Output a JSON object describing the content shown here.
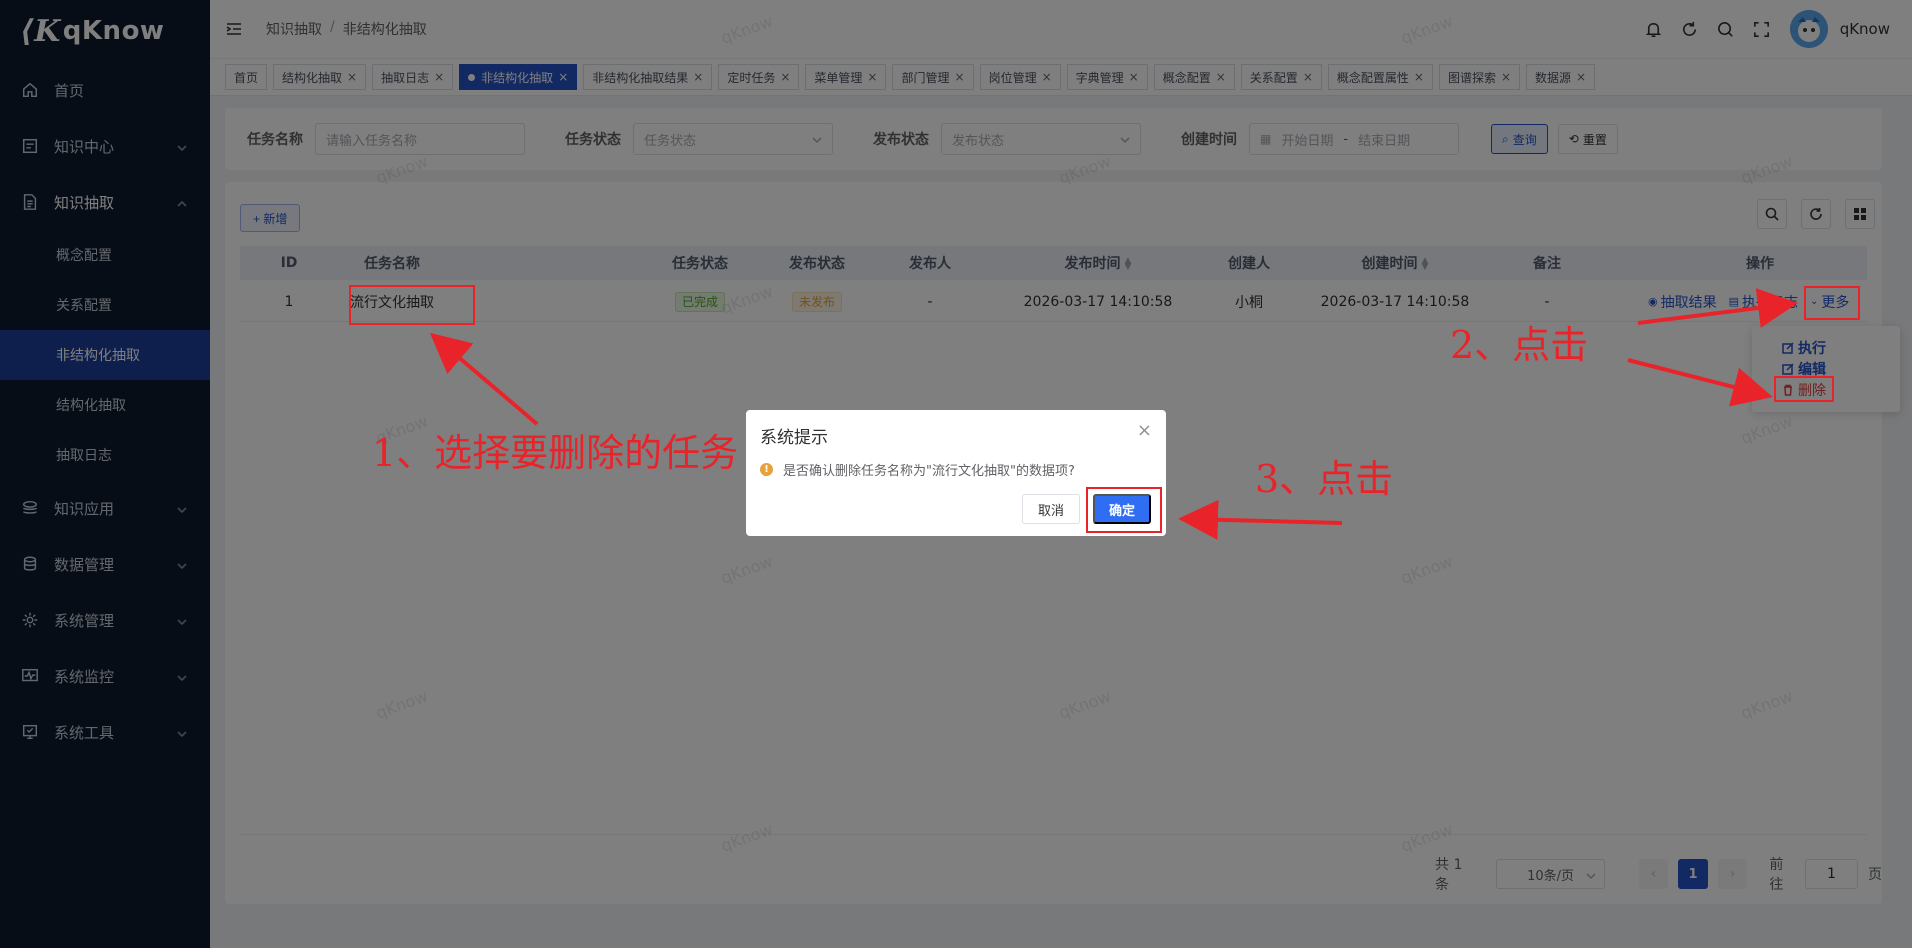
{
  "app": {
    "logo": "qKnow"
  },
  "sidebar": {
    "items": [
      {
        "label": "首页",
        "icon": "home-icon"
      },
      {
        "label": "知识中心",
        "icon": "book-icon"
      },
      {
        "label": "知识抽取",
        "icon": "document-icon"
      },
      {
        "label": "知识应用",
        "icon": "layers-icon"
      },
      {
        "label": "数据管理",
        "icon": "database-icon"
      },
      {
        "label": "系统管理",
        "icon": "gear-icon"
      },
      {
        "label": "系统监控",
        "icon": "monitor-icon"
      },
      {
        "label": "系统工具",
        "icon": "tool-icon"
      }
    ],
    "sub_items": [
      "概念配置",
      "关系配置",
      "非结构化抽取",
      "结构化抽取",
      "抽取日志"
    ]
  },
  "header": {
    "breadcrumb": [
      "知识抽取",
      "非结构化抽取"
    ],
    "username": "qKnow"
  },
  "tags": [
    "首页",
    "结构化抽取",
    "抽取日志",
    "非结构化抽取",
    "非结构化抽取结果",
    "定时任务",
    "菜单管理",
    "部门管理",
    "岗位管理",
    "字典管理",
    "概念配置",
    "关系配置",
    "概念配置属性",
    "图谱探索",
    "数据源"
  ],
  "search": {
    "task_name_label": "任务名称",
    "task_name_placeholder": "请输入任务名称",
    "task_status_label": "任务状态",
    "task_status_placeholder": "任务状态",
    "publish_status_label": "发布状态",
    "publish_status_placeholder": "发布状态",
    "create_time_label": "创建时间",
    "start_placeholder": "开始日期",
    "range_sep": "-",
    "end_placeholder": "结束日期",
    "query_label": "查询",
    "reset_label": "重置"
  },
  "toolbar": {
    "add_label": "+ 新增"
  },
  "table": {
    "columns": [
      "ID",
      "任务名称",
      "任务状态",
      "发布状态",
      "发布人",
      "发布时间",
      "创建人",
      "创建时间",
      "备注",
      "操作"
    ],
    "rows": [
      {
        "id": "1",
        "name": "流行文化抽取",
        "status": "已完成",
        "publish_status": "未发布",
        "publisher": "-",
        "publish_time": "2026-03-17 14:10:58",
        "creator": "小桐",
        "create_time": "2026-03-17 14:10:58",
        "remark": "-",
        "op_result": "抽取结果",
        "op_log": "执行日志",
        "op_more": "更多"
      }
    ]
  },
  "dropdown": {
    "execute": "执行",
    "edit": "编辑",
    "delete": "删除"
  },
  "pagination": {
    "total": "共 1 条",
    "page_size": "10条/页",
    "current": "1",
    "goto_prefix": "前往",
    "goto_value": "1",
    "goto_suffix": "页",
    "prev": "‹",
    "next": "›"
  },
  "dialog": {
    "title": "系统提示",
    "close": "×",
    "message": "是否确认删除任务名称为\"流行文化抽取\"的数据项?",
    "cancel": "取消",
    "confirm": "确定"
  },
  "annotations": {
    "step1": "1、选择要删除的任务",
    "step2": "2、点击",
    "step3": "3、点击"
  },
  "watermark": "qKnow",
  "colors": {
    "primary": "#2753c9",
    "sidebar": "#0f1a2c",
    "annotation": "#e8242a",
    "success": "#52a428",
    "warning": "#e6a23c"
  }
}
